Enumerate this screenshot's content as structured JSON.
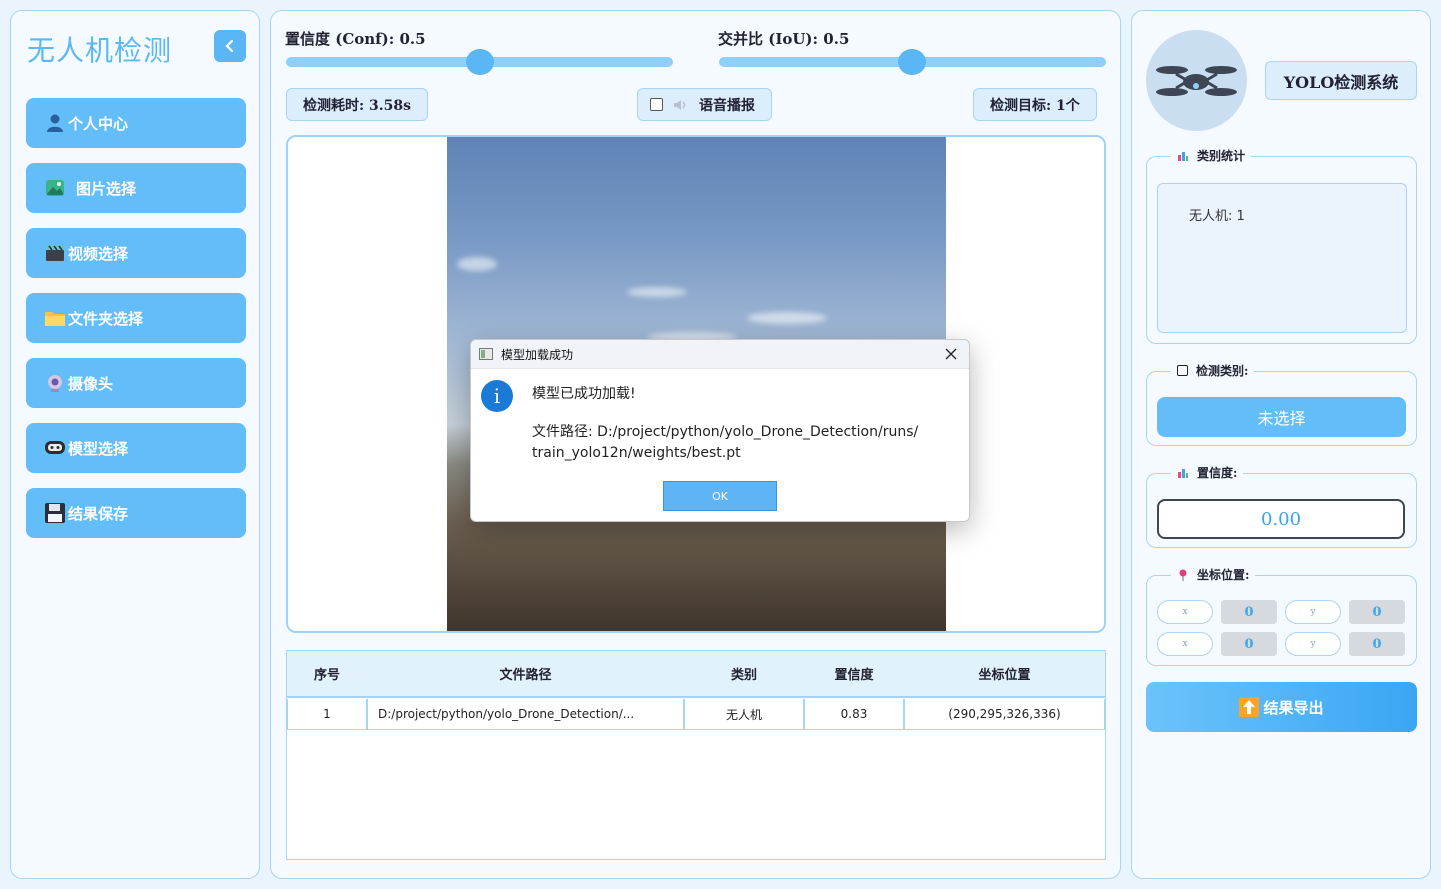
{
  "sidebar": {
    "title": "无人机检测",
    "items": [
      {
        "label": "个人中心",
        "icon": "person-icon"
      },
      {
        "label": "图片选择",
        "icon": "image-icon"
      },
      {
        "label": "视频选择",
        "icon": "clapperboard-icon"
      },
      {
        "label": "文件夹选择",
        "icon": "folder-icon"
      },
      {
        "label": "摄像头",
        "icon": "webcam-icon"
      },
      {
        "label": "模型选择",
        "icon": "model-icon"
      },
      {
        "label": "结果保存",
        "icon": "floppy-disk-icon"
      }
    ]
  },
  "controls": {
    "conf_label": "置信度 (Conf): 0.5",
    "conf_value": 0.5,
    "iou_label": "交并比 (IoU): 0.5",
    "iou_value": 0.5,
    "time_label": "检测耗时: 3.58s",
    "voice_label": "语音播报",
    "voice_checked": false,
    "targets_label": "检测目标: 1个"
  },
  "table": {
    "headers": [
      "序号",
      "文件路径",
      "类别",
      "置信度",
      "坐标位置"
    ],
    "rows": [
      [
        "1",
        "D:/project/python/yolo_Drone_Detection/...",
        "无人机",
        "0.83",
        "(290,295,326,336)"
      ]
    ]
  },
  "dialog": {
    "title": "模型加载成功",
    "message": "模型已成功加载!",
    "path_line1": "文件路径: D:/project/python/yolo_Drone_Detection/runs/",
    "path_line2": "train_yolo12n/weights/best.pt",
    "ok_label": "OK"
  },
  "right_panel": {
    "system_title": "YOLO检测系统",
    "stats_legend": "类别统计",
    "stats_text": "无人机: 1",
    "class_legend": "检测类别:",
    "class_select": "未选择",
    "conf_legend": "置信度:",
    "conf_value": "0.00",
    "coord_legend": "坐标位置:",
    "coords": [
      {
        "key": "x",
        "value": "0"
      },
      {
        "key": "y",
        "value": "0"
      },
      {
        "key": "x",
        "value": "0"
      },
      {
        "key": "y",
        "value": "0"
      }
    ],
    "export_label": "结果导出"
  },
  "colors": {
    "accent": "#62bdf8",
    "panel_border": "#a9d5f5",
    "background": "#eaf4fc"
  }
}
